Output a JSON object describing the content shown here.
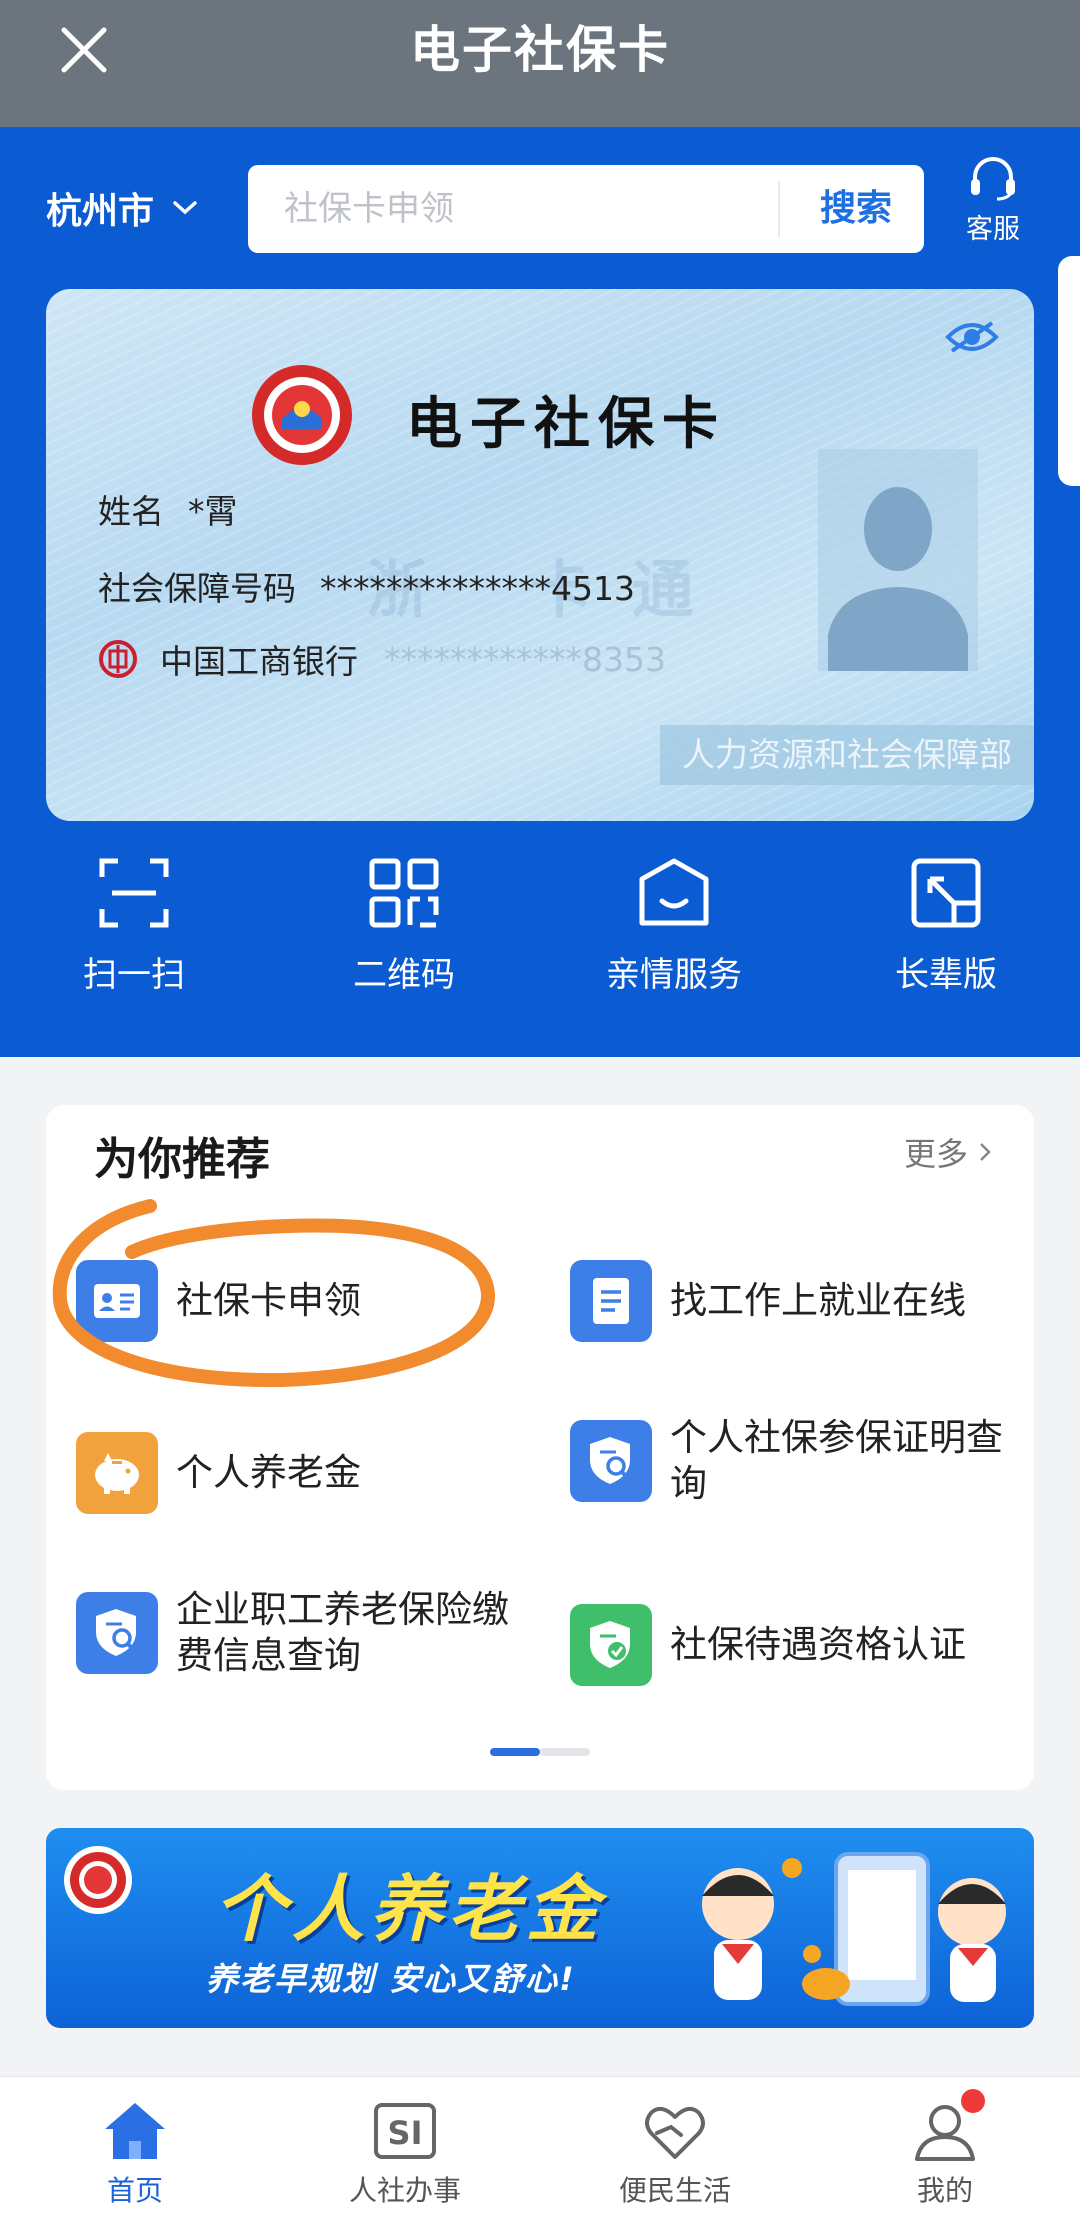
{
  "header": {
    "title": "电子社保卡"
  },
  "location": {
    "city": "杭州市"
  },
  "search": {
    "placeholder": "社保卡申领",
    "button": "搜索"
  },
  "service": {
    "label": "客服"
  },
  "card": {
    "title": "电子社保卡",
    "name_label": "姓名",
    "name_value": "*霄",
    "ssn_label": "社会保障号码",
    "ssn_value": "**************4513",
    "bank_name": "中国工商银行",
    "bank_no": "************8353",
    "issuer": "人力资源和社会保障部"
  },
  "quick_actions": [
    {
      "label": "扫一扫",
      "icon": "scan-icon"
    },
    {
      "label": "二维码",
      "icon": "qrcode-icon"
    },
    {
      "label": "亲情服务",
      "icon": "family-service-icon"
    },
    {
      "label": "长辈版",
      "icon": "elder-mode-icon"
    }
  ],
  "recommend": {
    "title": "为你推荐",
    "more": "更多",
    "items": [
      {
        "label": "社保卡申领",
        "icon": "id-card-icon",
        "color": "#3d7fe6"
      },
      {
        "label": "找工作上就业在线",
        "icon": "document-icon",
        "color": "#3d7fe6"
      },
      {
        "label": "个人养老金",
        "icon": "piggy-bank-icon",
        "color": "#f2a23c"
      },
      {
        "label": "个人社保参保证明查询",
        "icon": "shield-search-icon",
        "color": "#3d7fe6"
      },
      {
        "label": "企业职工养老保险缴费信息查询",
        "icon": "shield-search-icon",
        "color": "#3d7fe6"
      },
      {
        "label": "社保待遇资格认证",
        "icon": "shield-check-icon",
        "color": "#3fbf6b"
      }
    ]
  },
  "banner": {
    "title": "个人养老金",
    "subtitle": "养老早规划 安心又舒心!"
  },
  "tabbar": [
    {
      "label": "首页",
      "icon": "home-icon",
      "active": true
    },
    {
      "label": "人社办事",
      "icon": "si-icon",
      "active": false
    },
    {
      "label": "便民生活",
      "icon": "heart-hand-icon",
      "active": false
    },
    {
      "label": "我的",
      "icon": "user-icon",
      "active": false
    }
  ],
  "colors": {
    "primary": "#0b5bd3",
    "header": "#6c757d",
    "annotation": "#f28a2e"
  }
}
